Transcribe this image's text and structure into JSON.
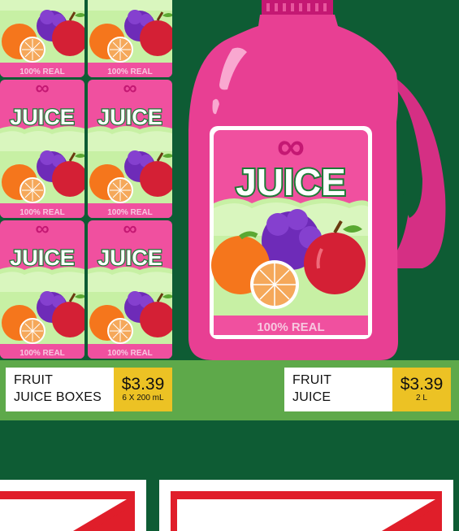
{
  "products": [
    {
      "name": "FRUIT\nJUICE BOXES",
      "price": "$3.39",
      "unit": "6 X 200 mL"
    },
    {
      "name": "FRUIT\nJUICE",
      "price": "$3.39",
      "unit": "2 L"
    }
  ],
  "label_art": {
    "brand_symbol": "∞",
    "brand_word": "JUICE",
    "tagline": "100% REAL"
  },
  "colors": {
    "background": "#0e5c34",
    "shelf": "#5ea94a",
    "jug_pink": "#e83f93",
    "label_pink": "#f0509f",
    "price_yellow": "#ecc224",
    "crate_red": "#e01e2a"
  }
}
